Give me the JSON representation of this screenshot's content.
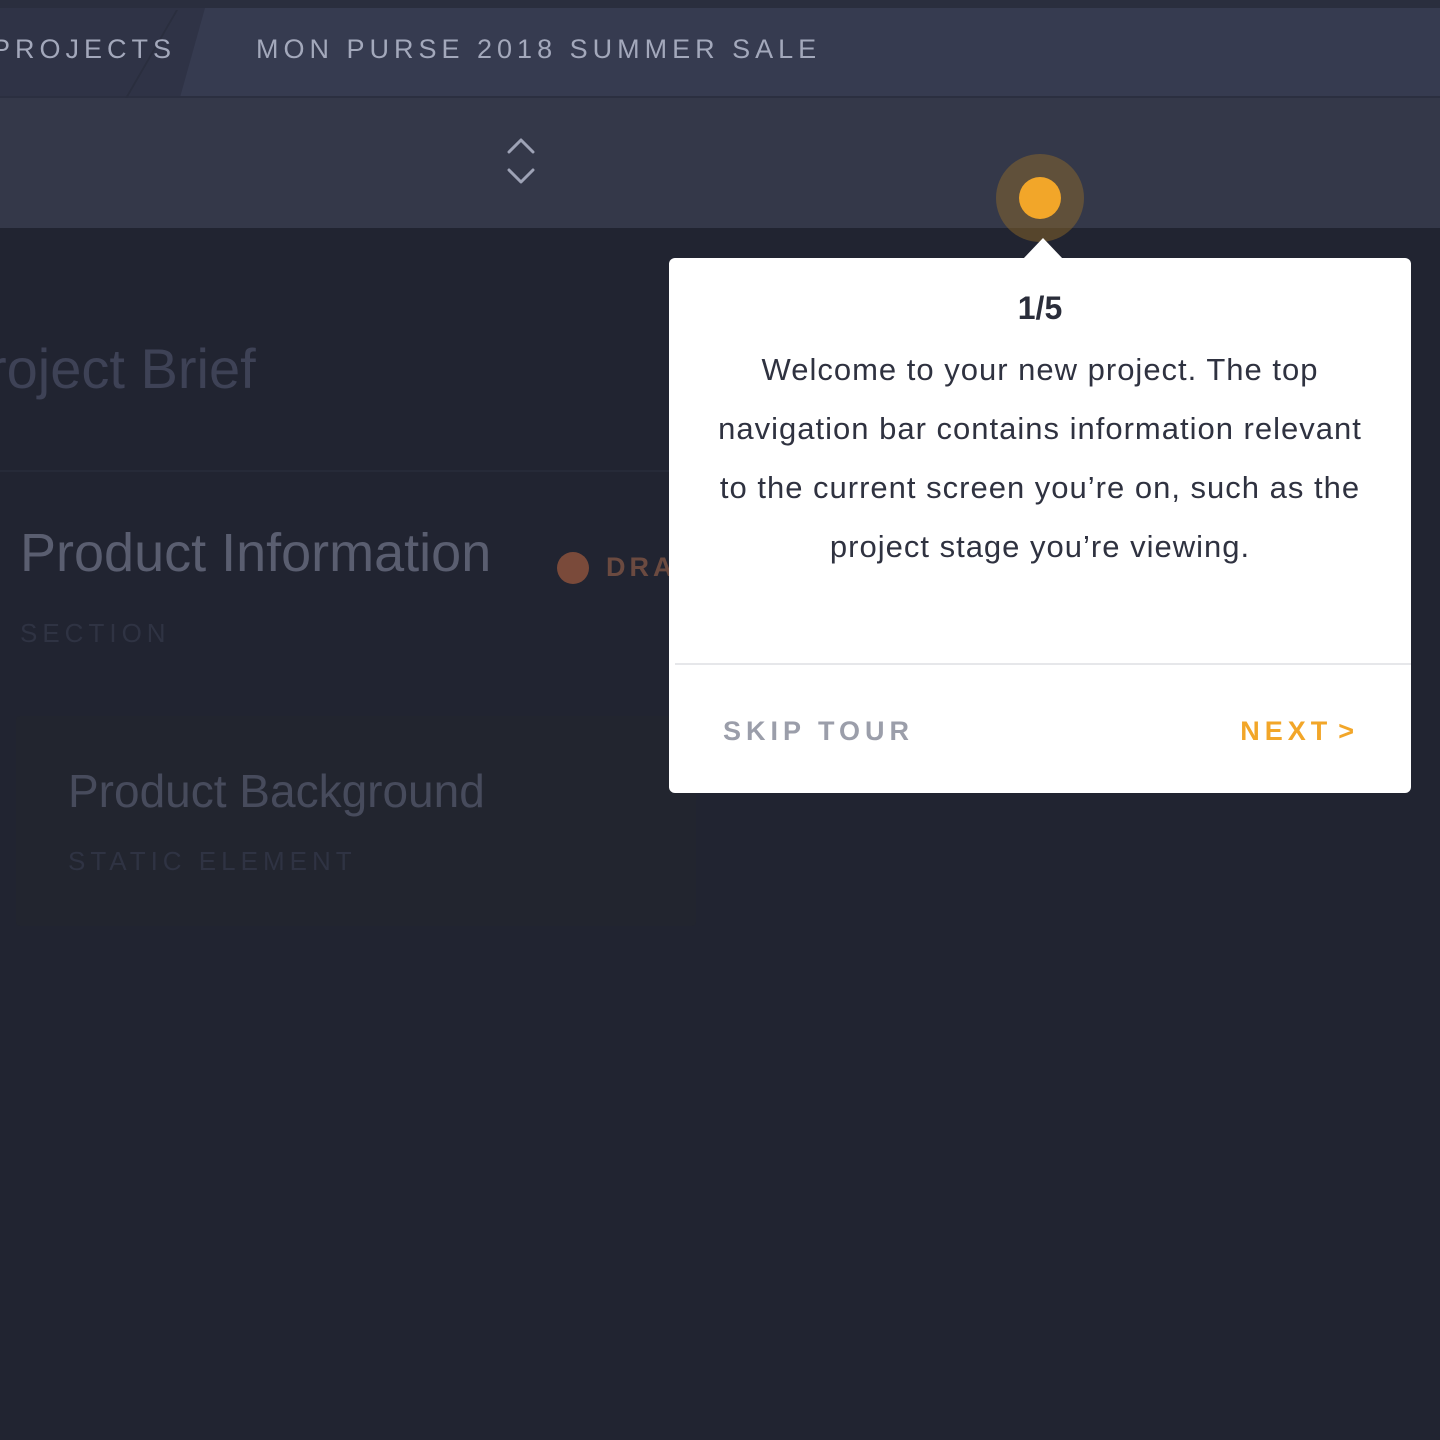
{
  "breadcrumb": {
    "root_label": "PROJECTS",
    "current_label": "MON PURSE 2018 SUMMER SALE"
  },
  "icons": {
    "stage_toggle": "chevron-up-down-icon",
    "status_dot": "status-dot-icon",
    "next_chevron": "chevron-right-icon"
  },
  "page": {
    "title": "roject Brief",
    "section": {
      "title": "Product Information",
      "status_label": "DRA",
      "type_label": "SECTION"
    },
    "element": {
      "title": "Product Background",
      "type_label": "STATIC ELEMENT"
    }
  },
  "tour": {
    "step": "1/5",
    "body": "Welcome to your new project. The top navigation bar contains information relevant to the current screen you’re on, such as the project stage you’re viewing.",
    "skip_label": "SKIP TOUR",
    "next_label": "NEXT",
    "next_chevron": ">"
  },
  "colors": {
    "background": "#212431",
    "topbar": "#363b50",
    "subbar": "#343849",
    "accent": "#f2a629",
    "tooltip_bg": "#ffffff",
    "muted_text": "#9b9eaa"
  }
}
